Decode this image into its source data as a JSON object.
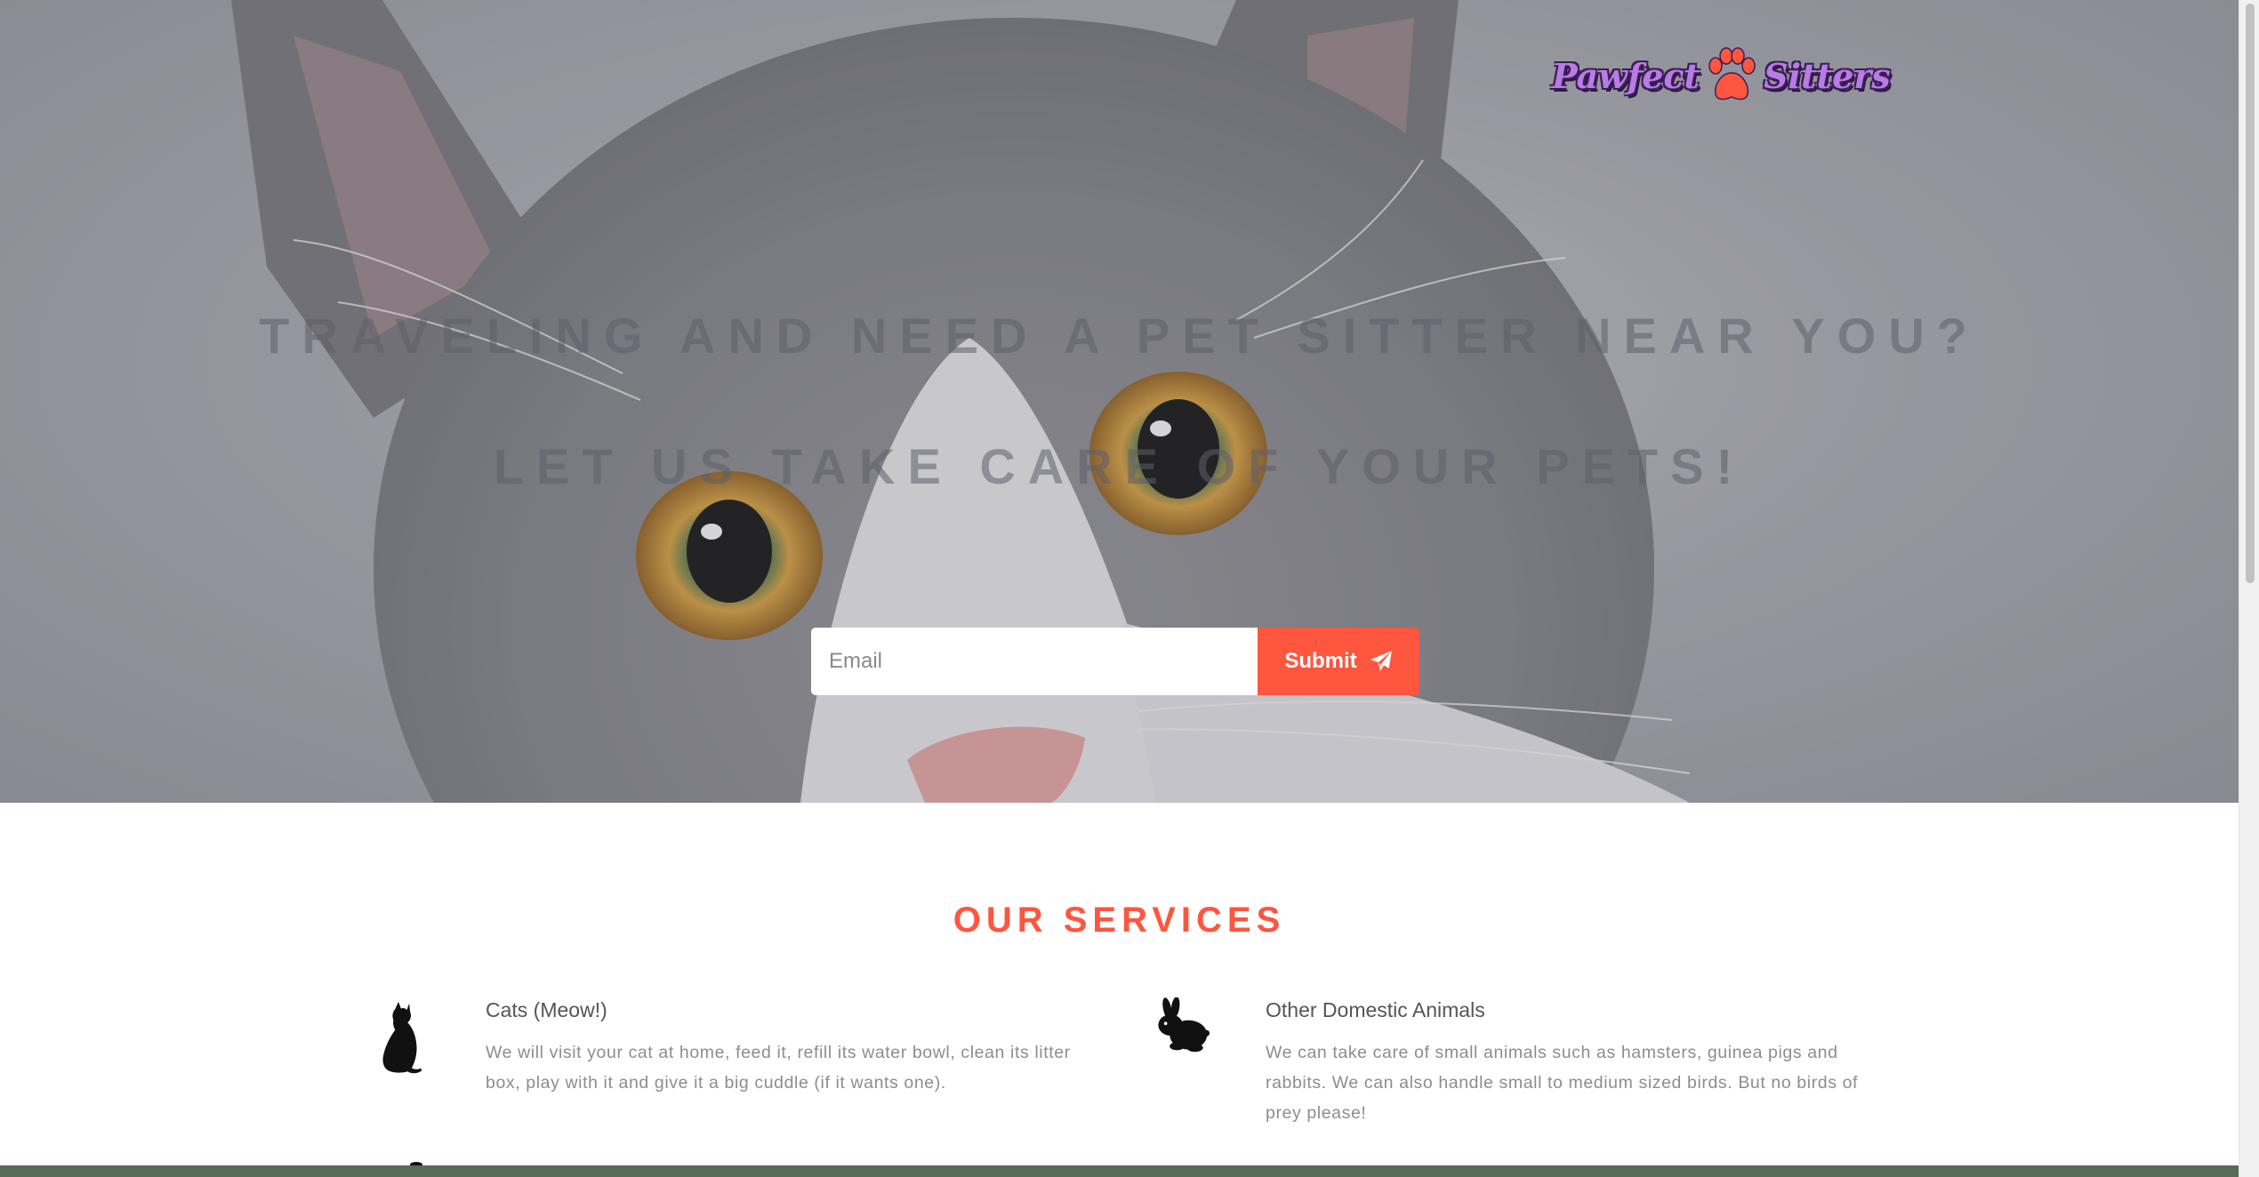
{
  "header": {
    "logo_left": "Pawfect",
    "logo_right": "Sitters"
  },
  "hero": {
    "headline": "Traveling and need a pet sitter near you?",
    "subheadline": "Let us take care of your pets!",
    "email_placeholder": "Email",
    "submit_label": "Submit"
  },
  "services": {
    "title": "OUR SERVICES",
    "items": [
      {
        "name": "Cats (Meow!)",
        "icon": "cat-icon",
        "description": "We will visit your cat at home, feed it, refill its water bowl, clean its litter box, play with it and give it a big cuddle (if it wants one)."
      },
      {
        "name": "Other Domestic Animals",
        "icon": "rabbit-icon",
        "description": "We can take care of small animals such as hamsters, guinea pigs and rabbits. We can also handle small to medium sized birds. But no birds of prey please!"
      }
    ]
  },
  "colors": {
    "accent": "#ff563f",
    "logo_purple": "#b97be6",
    "footer_band": "#566b58"
  }
}
